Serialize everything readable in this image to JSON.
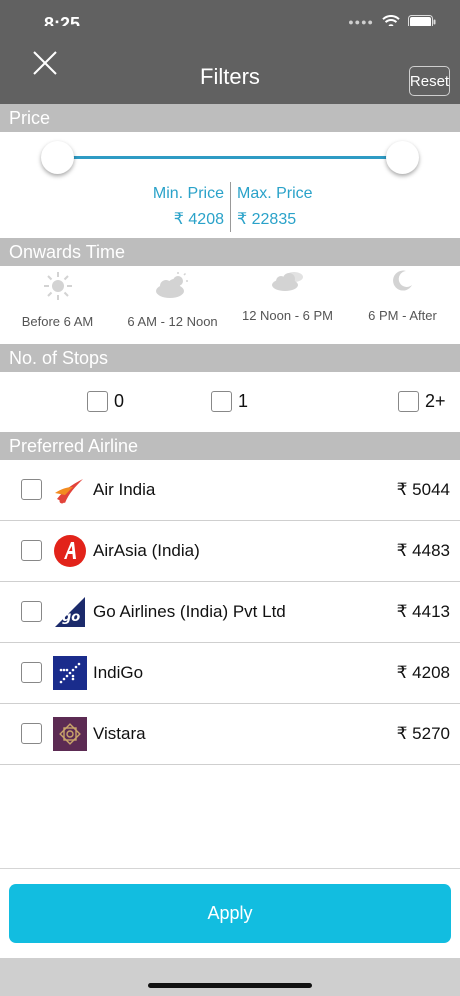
{
  "status": {
    "time": "8:25"
  },
  "header": {
    "title": "Filters",
    "reset_label": "Reset"
  },
  "sections": {
    "price": "Price",
    "onwards_time": "Onwards Time",
    "stops": "No. of Stops",
    "airline": "Preferred Airline"
  },
  "price": {
    "min_label": "Min. Price",
    "min_value": "₹ 4208",
    "max_label": "Max. Price",
    "max_value": "₹ 22835",
    "accent": "#2aa2c9"
  },
  "times": [
    {
      "label": "Before 6 AM",
      "icon": "sun-icon"
    },
    {
      "label": "6 AM - 12 Noon",
      "icon": "partly-cloudy-sun-icon"
    },
    {
      "label": "12 Noon - 6 PM",
      "icon": "cloudy-icon"
    },
    {
      "label": "6 PM - After",
      "icon": "moon-icon"
    }
  ],
  "stops": [
    "0",
    "1",
    "2+"
  ],
  "airlines": [
    {
      "name": "Air India",
      "price": "₹ 5044",
      "icon": "air-india-logo"
    },
    {
      "name": "AirAsia (India)",
      "price": "₹ 4483",
      "icon": "airasia-logo"
    },
    {
      "name": "Go Airlines (India) Pvt Ltd",
      "price": "₹ 4413",
      "icon": "goair-logo"
    },
    {
      "name": "IndiGo",
      "price": "₹ 4208",
      "icon": "indigo-logo"
    },
    {
      "name": "Vistara",
      "price": "₹ 5270",
      "icon": "vistara-logo"
    }
  ],
  "apply_label": "Apply",
  "colors": {
    "header": "#616161",
    "section": "#bdbdbd",
    "apply": "#12bde0"
  }
}
